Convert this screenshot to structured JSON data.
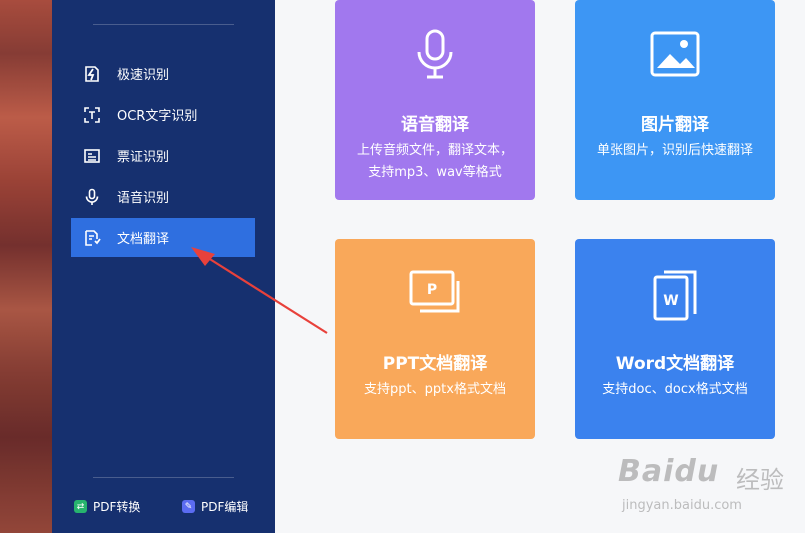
{
  "sidebar": {
    "items": [
      {
        "label": "极速识别",
        "icon": "flash-edit-icon"
      },
      {
        "label": "OCR文字识别",
        "icon": "ocr-scan-icon"
      },
      {
        "label": "票证识别",
        "icon": "ticket-icon"
      },
      {
        "label": "语音识别",
        "icon": "microphone-icon"
      },
      {
        "label": "文档翻译",
        "icon": "doc-translate-icon",
        "active": true
      }
    ],
    "tools": [
      {
        "label": "PDF转换",
        "icon": "pdf-convert-icon",
        "color": "#27b46e"
      },
      {
        "label": "PDF编辑",
        "icon": "pdf-edit-icon",
        "color": "#5b6cf2"
      }
    ]
  },
  "cards": [
    {
      "title": "语音翻译",
      "desc_line1": "上传音频文件，翻译文本，",
      "desc_line2": "支持mp3、wav等格式",
      "color": "#a178ee",
      "icon": "microphone-icon"
    },
    {
      "title": "图片翻译",
      "desc_line1": "单张图片，识别后快速翻译",
      "desc_line2": "",
      "color": "#3d96f4",
      "icon": "image-icon"
    },
    {
      "title": "PPT文档翻译",
      "desc_line1": "支持ppt、pptx格式文档",
      "desc_line2": "",
      "color": "#f9a85a",
      "icon": "ppt-file-icon"
    },
    {
      "title": "Word文档翻译",
      "desc_line1": "支持doc、docx格式文档",
      "desc_line2": "",
      "color": "#3b82ee",
      "icon": "word-file-icon"
    }
  ],
  "accent_colors": {
    "sidebar_bg": "#16306f",
    "active_bg": "#2f6fe0",
    "arrow": "#e8413b"
  },
  "watermark": {
    "brand": "Baidu",
    "brand_cn": "经验",
    "url": "jingyan.baidu.com"
  }
}
